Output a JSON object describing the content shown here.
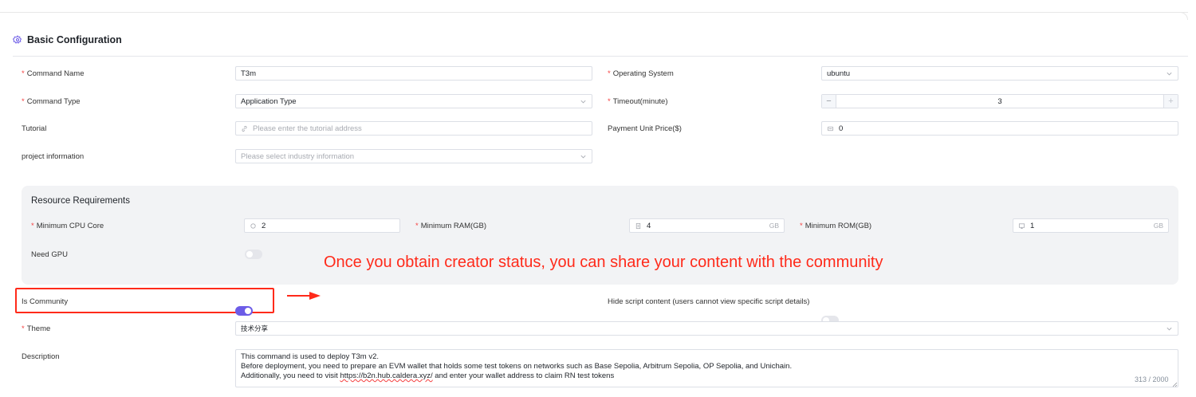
{
  "section": {
    "title": "Basic Configuration",
    "icon": "gear-icon"
  },
  "fields": {
    "command_name": {
      "label": "Command Name",
      "value": "T3m"
    },
    "operating_system": {
      "label": "Operating System",
      "value": "ubuntu"
    },
    "command_type": {
      "label": "Command Type",
      "value": "Application Type"
    },
    "timeout": {
      "label": "Timeout(minute)",
      "value": "3",
      "minus": "−",
      "plus": "+"
    },
    "tutorial": {
      "label": "Tutorial",
      "placeholder": "Please enter the tutorial address"
    },
    "payment": {
      "label": "Payment Unit Price($)",
      "value": "0"
    },
    "project": {
      "label": "project information",
      "placeholder": "Please select industry information"
    }
  },
  "resources": {
    "title": "Resource Requirements",
    "cpu": {
      "label": "Minimum CPU Core",
      "value": "2"
    },
    "ram": {
      "label": "Minimum RAM(GB)",
      "value": "4",
      "suffix": "GB"
    },
    "rom": {
      "label": "Minimum ROM(GB)",
      "value": "1",
      "suffix": "GB"
    },
    "gpu": {
      "label": "Need GPU",
      "enabled": false
    }
  },
  "annotation": {
    "text": "Once you obtain creator status, you can share your content with the community",
    "color": "#ff2a1a"
  },
  "community": {
    "label": "Is Community",
    "enabled": true
  },
  "hide_script": {
    "label": "Hide script content (users cannot view specific script details)",
    "enabled": false
  },
  "theme": {
    "label": "Theme",
    "value": "技术分享"
  },
  "description": {
    "label": "Description",
    "line1": "This command is used to deploy T3m v2.",
    "line2": "Before deployment, you need to prepare an EVM wallet that holds some test tokens on networks such as Base Sepolia, Arbitrum Sepolia, OP Sepolia, and Unichain.",
    "line3_prefix": "Additionally, you need to visit ",
    "line3_link": "https://b2n.hub.caldera.xyz/",
    "line3_suffix": " and enter your wallet address to claim RN test tokens",
    "counter": "313 / 2000"
  },
  "colors": {
    "accent": "#6c5ce7",
    "required": "#f53f3f",
    "annotation": "#ff2a1a"
  },
  "required_mark": "*"
}
